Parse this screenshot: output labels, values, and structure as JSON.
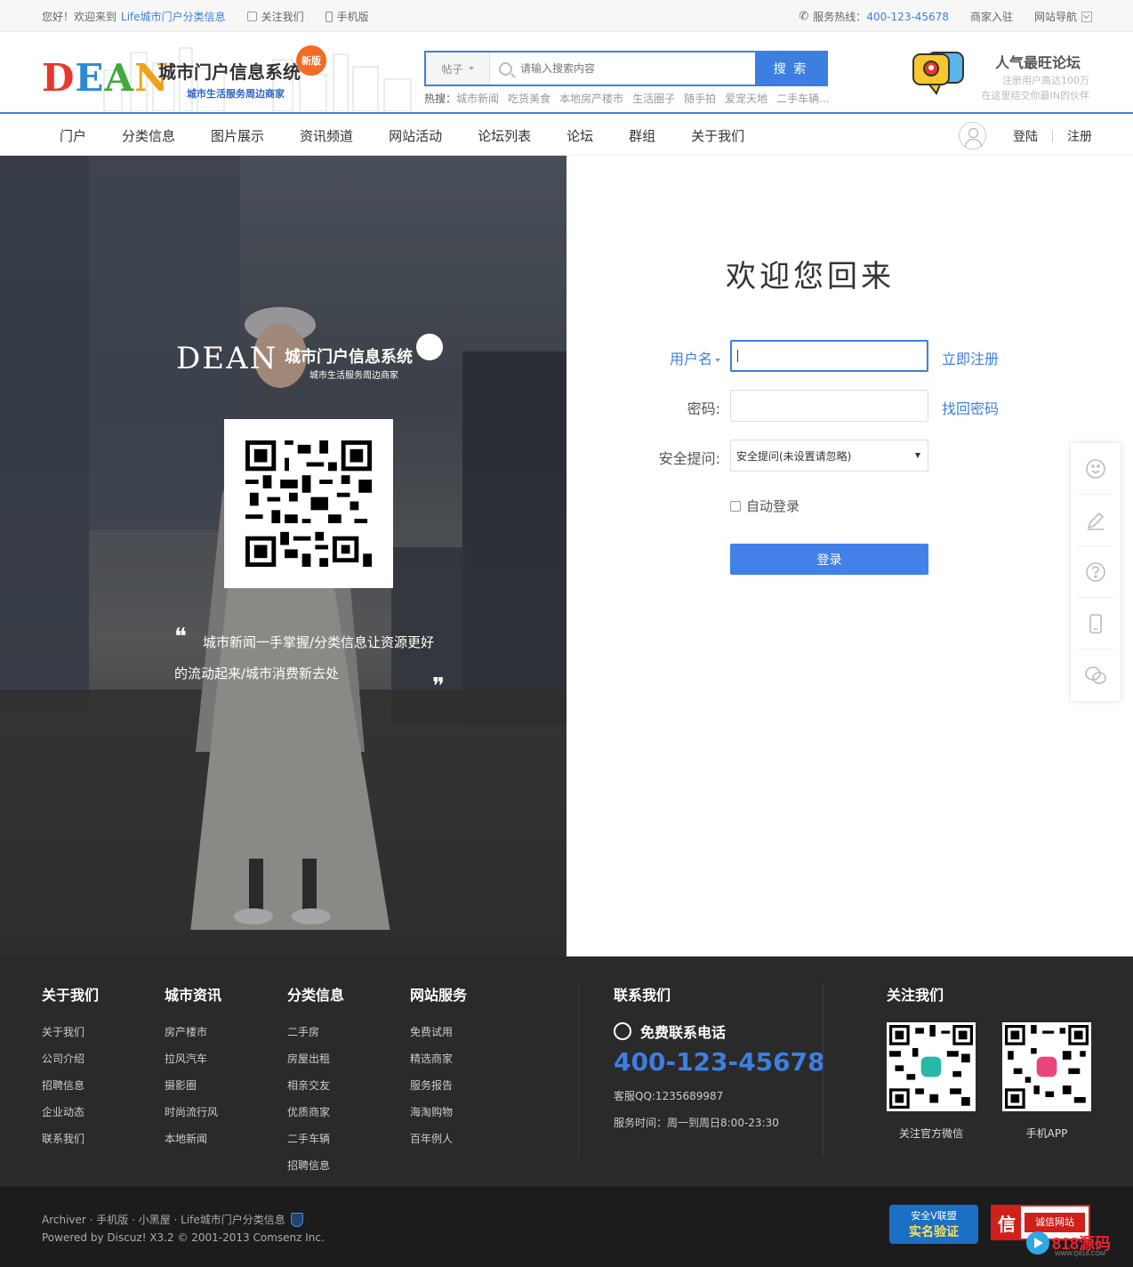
{
  "topbar": {
    "welcome_prefix": "您好！欢迎来到",
    "site_name": "Life城市门户分类信息",
    "follow": "关注我们",
    "mobile": "手机版",
    "hotline_label": "服务热线：",
    "hotline": "400-123-45678",
    "merchant": "商家入驻",
    "sitenav": "网站导航"
  },
  "header": {
    "logo_text": "DEAN",
    "logo_cn": "城市门户信息系统",
    "logo_sub": "城市生活服务周边商家",
    "logo_badge": "新版",
    "search": {
      "type": "帖子",
      "placeholder": "请输入搜索内容",
      "button": "搜 索"
    },
    "hot_label": "热搜：",
    "hot": [
      "城市新闻",
      "吃货美食",
      "本地房产楼市",
      "生活圈子",
      "随手拍",
      "爱宠天地",
      "二手车辆..."
    ],
    "promo": {
      "title": "人气最旺论坛",
      "line1": "注册用户高达100万",
      "line2": "在这里结交你最IN的伙伴"
    }
  },
  "nav": {
    "items": [
      "门户",
      "分类信息",
      "图片展示",
      "资讯频道",
      "网站活动",
      "论坛列表",
      "论坛",
      "群组",
      "关于我们"
    ],
    "login": "登陆",
    "register": "注册"
  },
  "hero": {
    "logo_text": "DEAN",
    "logo_cn": "城市门户信息系统",
    "logo_sub": "城市生活服务周边商家",
    "quote": "城市新闻一手掌握/分类信息让资源更好的流动起来/城市消费新去处"
  },
  "login": {
    "title": "欢迎您回来",
    "username_label": "用户名",
    "register_link": "立即注册",
    "password_label": "密码:",
    "forgot_link": "找回密码",
    "question_label": "安全提问:",
    "question_value": "安全提问(未设置请忽略)",
    "auto_login": "自动登录",
    "submit": "登录"
  },
  "sidebar_icons": [
    "smile-icon",
    "pencil-icon",
    "question-icon",
    "mobile-icon",
    "wechat-icon"
  ],
  "footer": {
    "cols": [
      {
        "title": "关于我们",
        "items": [
          "关于我们",
          "公司介绍",
          "招聘信息",
          "企业动态",
          "联系我们"
        ]
      },
      {
        "title": "城市资讯",
        "items": [
          "房产楼市",
          "拉风汽车",
          "摄影圈",
          "时尚流行风",
          "本地新闻"
        ]
      },
      {
        "title": "分类信息",
        "items": [
          "二手房",
          "房屋出租",
          "相亲交友",
          "优质商家",
          "二手车辆",
          "招聘信息"
        ]
      },
      {
        "title": "网站服务",
        "items": [
          "免费试用",
          "精选商家",
          "服务报告",
          "海淘购物",
          "百年例人"
        ]
      }
    ],
    "contact": {
      "title": "联系我们",
      "free": "免费联系电话",
      "tel": "400-123-45678",
      "qq": "客服QQ:1235689987",
      "time": "服务时间：周一到周日8:00-23:30"
    },
    "follow": {
      "title": "关注我们",
      "wechat": "关注官方微信",
      "app": "手机APP"
    }
  },
  "bottom": {
    "links": "Archiver · 手机版 · 小黑屋 · Life城市门户分类信息",
    "powered": "Powered by Discuz! X3.2  © 2001-2013 Comsenz Inc.",
    "badge1_top": "安全V联盟",
    "badge1_main": "实名验证",
    "badge2_char": "信",
    "badge2_text": "诚信网站",
    "watermark": "818源码",
    "watermark_sub": "WWW.Q818.COM"
  },
  "colors": {
    "accent": "#3d7fe0",
    "footer_bg": "#2a2a2a",
    "bottom_bg": "#1c1c1c"
  }
}
